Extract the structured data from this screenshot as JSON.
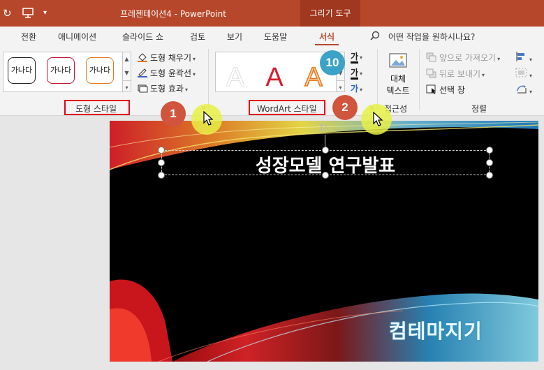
{
  "titlebar": {
    "title": "프레젠테이션4  -  PowerPoint",
    "context_tab": "그리기 도구",
    "undo_icon": "refresh-icon",
    "slideshow_icon": "presenter-icon",
    "customize_icon": "dropdown-icon"
  },
  "tabs": [
    {
      "label": "전환"
    },
    {
      "label": "애니메이션"
    },
    {
      "label": "슬라이드 쇼"
    },
    {
      "label": "검토"
    },
    {
      "label": "보기"
    },
    {
      "label": "도움말"
    },
    {
      "label": "서식",
      "active": true
    }
  ],
  "tell_me": {
    "placeholder": "어떤 작업을 원하시나요?",
    "icon": "search-icon"
  },
  "shape_styles": {
    "thumbs": [
      "가나다",
      "가나다",
      "가나다"
    ],
    "fill": "도형 채우기",
    "outline": "도형 윤곽선",
    "effects": "도형 효과",
    "label": "도형 스타일"
  },
  "wordart": {
    "letters": [
      "A",
      "A",
      "A"
    ],
    "text_buttons": [
      "가",
      "가",
      "가"
    ],
    "label": "WordArt 스타일"
  },
  "accessibility": {
    "alt_text_line1": "대체",
    "alt_text_line2": "텍스트",
    "label": "접근성"
  },
  "arrange": {
    "bring_forward": "앞으로 가져오기",
    "send_backward": "뒤로 보내기",
    "selection_pane": "선택 창",
    "label": "정렬"
  },
  "badges": {
    "one": "1",
    "two": "2",
    "ten": "10"
  },
  "slide": {
    "title": "성장모델 연구발표",
    "watermark": "컴테마지기"
  },
  "colors": {
    "accent": "#b7472a",
    "highlight_box": "#e4001b",
    "badge_red": "#d0553c",
    "badge_blue": "#3aa3c7"
  }
}
